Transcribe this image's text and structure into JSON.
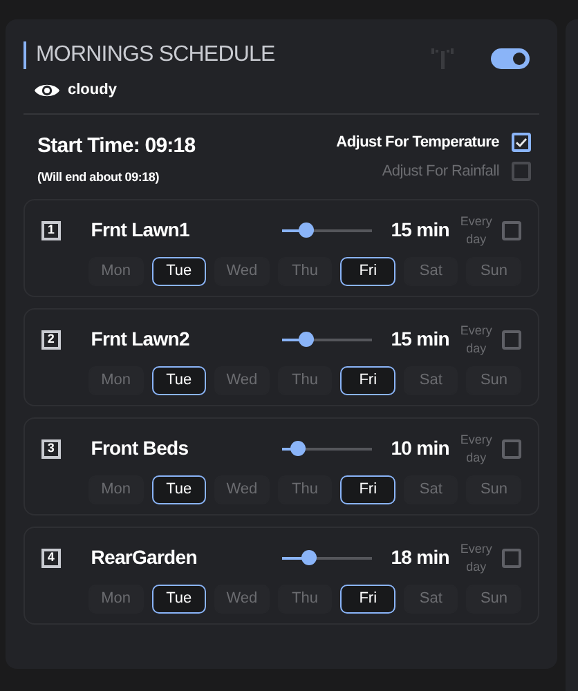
{
  "schedule": {
    "title": "MORNINGS SCHEDULE",
    "weather": "cloudy",
    "enabled": true,
    "start_time": "Start Time: 09:18",
    "end_note": "(Will end about 09:18)",
    "options": [
      {
        "label": "Adjust For Temperature",
        "checked": true,
        "disabled": false
      },
      {
        "label": "Adjust For Rainfall",
        "checked": false,
        "disabled": true
      }
    ],
    "zones": [
      {
        "number": "1",
        "name": "Frnt Lawn1",
        "level": 0.26,
        "duration": "15 min",
        "every_day_label": "Every day",
        "every_day": false,
        "days": [
          {
            "label": "Mon",
            "selected": false
          },
          {
            "label": "Tue",
            "selected": true
          },
          {
            "label": "Wed",
            "selected": false
          },
          {
            "label": "Thu",
            "selected": false
          },
          {
            "label": "Fri",
            "selected": true
          },
          {
            "label": "Sat",
            "selected": false
          },
          {
            "label": "Sun",
            "selected": false
          }
        ]
      },
      {
        "number": "2",
        "name": "Frnt Lawn2",
        "level": 0.26,
        "duration": "15 min",
        "every_day_label": "Every day",
        "every_day": false,
        "days": [
          {
            "label": "Mon",
            "selected": false
          },
          {
            "label": "Tue",
            "selected": true
          },
          {
            "label": "Wed",
            "selected": false
          },
          {
            "label": "Thu",
            "selected": false
          },
          {
            "label": "Fri",
            "selected": true
          },
          {
            "label": "Sat",
            "selected": false
          },
          {
            "label": "Sun",
            "selected": false
          }
        ]
      },
      {
        "number": "3",
        "name": "Front Beds",
        "level": 0.17,
        "duration": "10 min",
        "every_day_label": "Every day",
        "every_day": false,
        "days": [
          {
            "label": "Mon",
            "selected": false
          },
          {
            "label": "Tue",
            "selected": true
          },
          {
            "label": "Wed",
            "selected": false
          },
          {
            "label": "Thu",
            "selected": false
          },
          {
            "label": "Fri",
            "selected": true
          },
          {
            "label": "Sat",
            "selected": false
          },
          {
            "label": "Sun",
            "selected": false
          }
        ]
      },
      {
        "number": "4",
        "name": "RearGarden",
        "level": 0.3,
        "duration": "18 min",
        "every_day_label": "Every day",
        "every_day": false,
        "days": [
          {
            "label": "Mon",
            "selected": false
          },
          {
            "label": "Tue",
            "selected": true
          },
          {
            "label": "Wed",
            "selected": false
          },
          {
            "label": "Thu",
            "selected": false
          },
          {
            "label": "Fri",
            "selected": true
          },
          {
            "label": "Sat",
            "selected": false
          },
          {
            "label": "Sun",
            "selected": false
          }
        ]
      }
    ]
  }
}
